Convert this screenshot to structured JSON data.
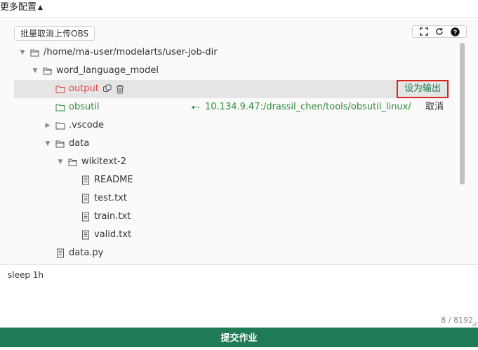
{
  "header": {
    "more_config_label": "更多配置"
  },
  "toolbar": {
    "batch_cancel_label": "批量取消上传OBS"
  },
  "tree": {
    "rows": [
      {
        "label": "/home/ma-user/modelarts/user-job-dir"
      },
      {
        "label": "word_language_model"
      },
      {
        "label": "output"
      },
      {
        "label": "obsutil"
      },
      {
        "label": ".vscode"
      },
      {
        "label": "data"
      },
      {
        "label": "wikitext-2"
      },
      {
        "label": "README"
      },
      {
        "label": "test.txt"
      },
      {
        "label": "train.txt"
      },
      {
        "label": "valid.txt"
      },
      {
        "label": "data.py"
      }
    ],
    "set_output_label": "设为输出",
    "obsutil_mapping": "10.134.9.47:/drassil_chen/tools/obsutil_linux/",
    "cancel_label": "取消"
  },
  "command": {
    "value": "sleep 1h",
    "counter": "8 / 8192"
  },
  "footer": {
    "submit_label": "提交作业"
  },
  "colors": {
    "accent": "#1f7a56",
    "highlight_border": "#d9261c",
    "output_red": "#e64545",
    "mapped_green": "#2e8b3a"
  }
}
